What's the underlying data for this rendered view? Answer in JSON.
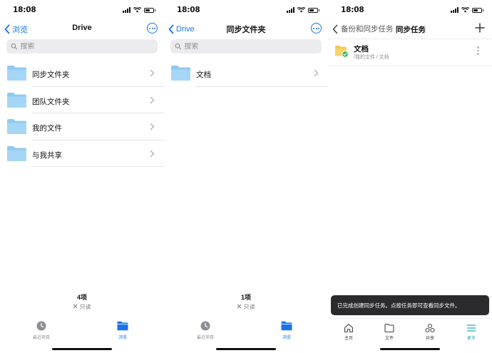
{
  "status": {
    "time": "18:08"
  },
  "screen1": {
    "back_label": "浏览",
    "title": "Drive",
    "search_placeholder": "搜索",
    "items": [
      {
        "label": "同步文件夹"
      },
      {
        "label": "团队文件夹"
      },
      {
        "label": "我的文件"
      },
      {
        "label": "与我共享"
      }
    ],
    "count": "4项",
    "readonly": "只读",
    "tabs": [
      {
        "label": "最近项目",
        "icon": "clock-icon",
        "active": false
      },
      {
        "label": "浏览",
        "icon": "folder-icon",
        "active": true
      }
    ]
  },
  "screen2": {
    "back_label": "Drive",
    "title": "同步文件夹",
    "search_placeholder": "搜索",
    "items": [
      {
        "label": "文档"
      }
    ],
    "count": "1项",
    "readonly": "只读",
    "tabs": [
      {
        "label": "最近项目",
        "icon": "clock-icon",
        "active": false
      },
      {
        "label": "浏览",
        "icon": "folder-icon",
        "active": true
      }
    ]
  },
  "screen3": {
    "back_label": "备份和同步任务",
    "title": "同步任务",
    "task": {
      "name": "文档",
      "path": "/我的文件 / 文档"
    },
    "toast": "已完成创建同步任务。点按任务即可查看同步文件。",
    "tabs": [
      {
        "label": "主页",
        "icon": "home-icon",
        "active": false
      },
      {
        "label": "文件",
        "icon": "folder-outline-icon",
        "active": false
      },
      {
        "label": "共享",
        "icon": "share-icon",
        "active": false
      },
      {
        "label": "更多",
        "icon": "menu-icon",
        "active": true
      }
    ]
  },
  "colors": {
    "accent": "#1a73e8",
    "folder": "#8fcaf0",
    "task_folder": "#f5c752",
    "sync_check": "#34b34a",
    "more_tab": "#2aa6b8"
  }
}
